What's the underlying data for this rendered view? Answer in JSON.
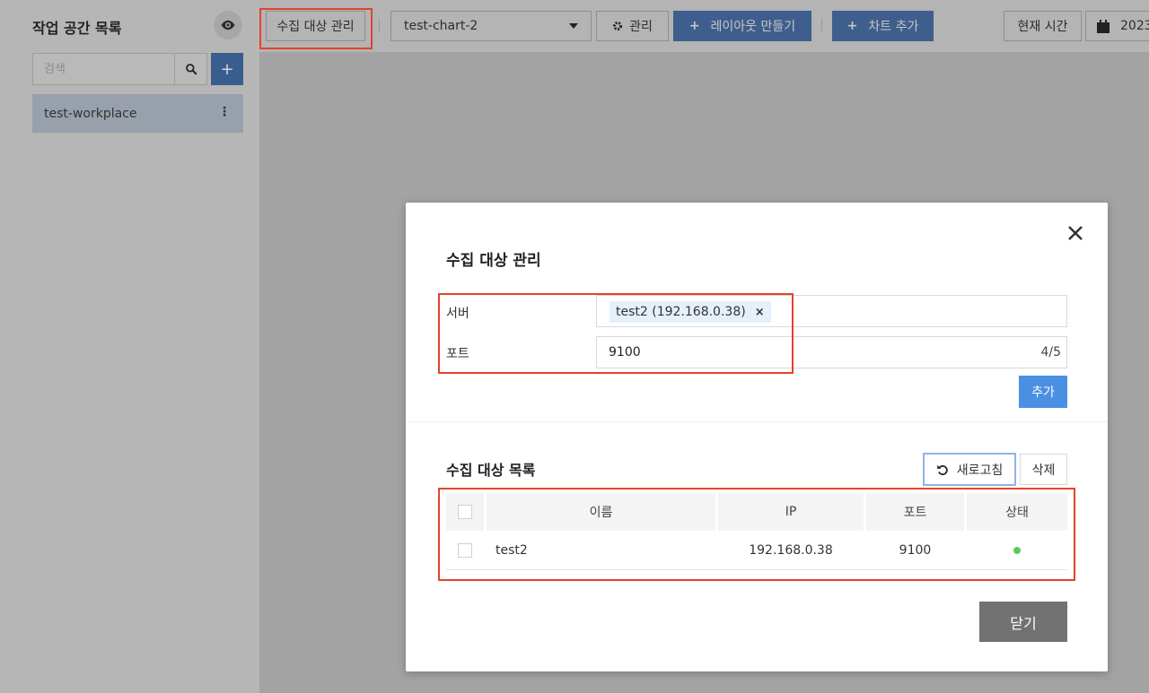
{
  "sidebar": {
    "title": "작업 공간 목록",
    "search_placeholder": "검색",
    "workspaces": [
      {
        "label": "test-workplace"
      }
    ]
  },
  "toolbar": {
    "collect_target_label": "수집 대상 관리",
    "chart_select_value": "test-chart-2",
    "manage_label": "관리",
    "create_layout_label": "레이아웃 만들기",
    "add_chart_label": "차트 추가",
    "current_time_label": "현재 시간",
    "date_partial": "2023"
  },
  "modal": {
    "title": "수집 대상 관리",
    "server_label": "서버",
    "server_tag": "test2 (192.168.0.38)",
    "port_label": "포트",
    "port_value": "9100",
    "port_counter": "4/5",
    "add_label": "추가",
    "list_title": "수집 대상 목록",
    "refresh_label": "새로고침",
    "delete_label": "삭제",
    "table": {
      "columns": [
        "이름",
        "IP",
        "포트",
        "상태"
      ],
      "rows": [
        {
          "name": "test2",
          "ip": "192.168.0.38",
          "port": "9100",
          "status_color": "#5cc95c"
        }
      ]
    },
    "close_label": "닫기"
  },
  "colors": {
    "primary": "#4a90e2",
    "highlight": "#e3432a",
    "status_ok": "#5cc95c"
  }
}
